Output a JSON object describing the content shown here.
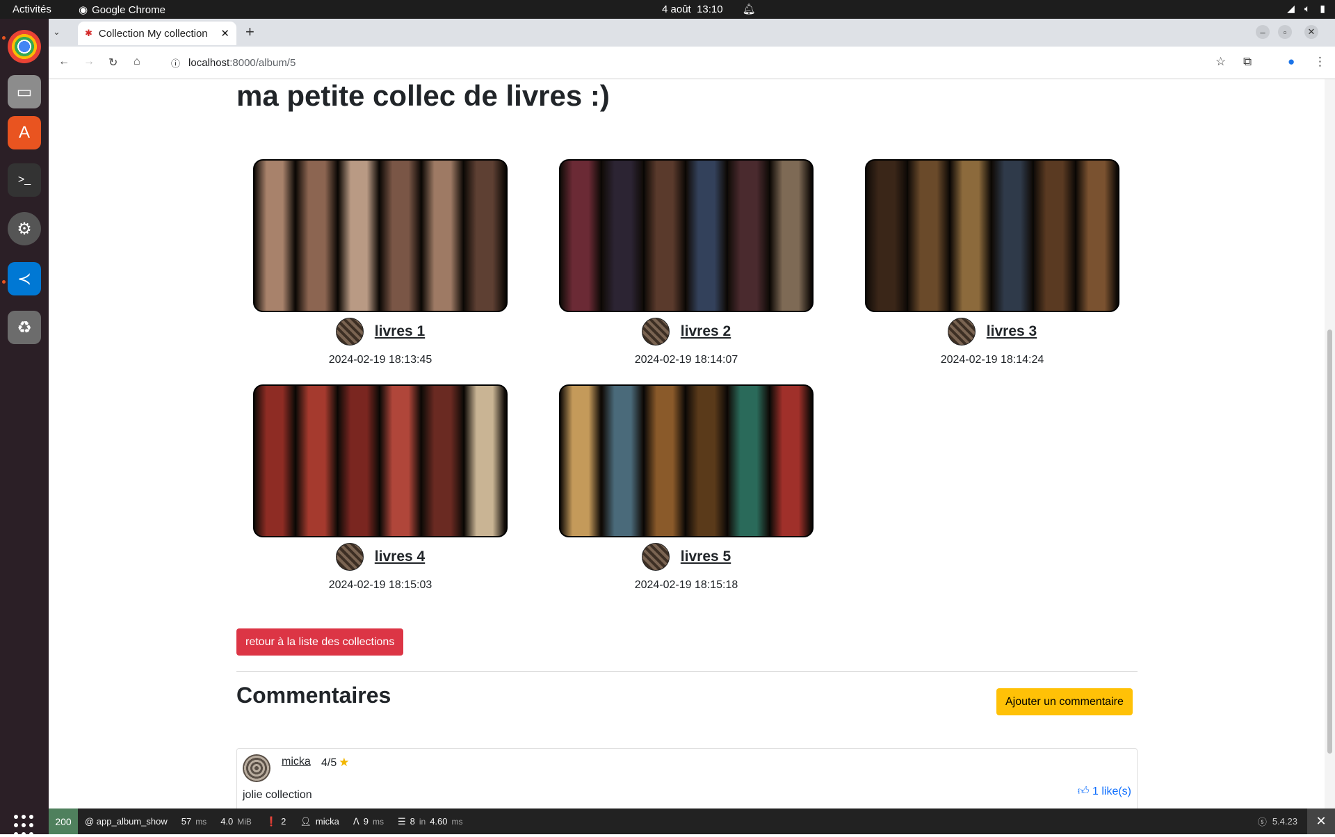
{
  "system": {
    "activities": "Activités",
    "app_name": "Google Chrome",
    "date": "4 août",
    "time": "13:10"
  },
  "browser": {
    "tab_title": "Collection My collection",
    "url_host": "localhost",
    "url_rest": ":8000/album/5"
  },
  "page": {
    "title": "ma petite collec de livres :)",
    "items": [
      {
        "name": "livres 1",
        "date": "2024-02-19 18:13:45",
        "palette": [
          "#a8826b",
          "#8c6551",
          "#b99a84",
          "#7a5646",
          "#9e7a64",
          "#5e4033"
        ]
      },
      {
        "name": "livres 2",
        "date": "2024-02-19 18:14:07",
        "palette": [
          "#6b2a35",
          "#2c2433",
          "#5a3a2c",
          "#33415b",
          "#4a2a2e",
          "#7e6a55"
        ]
      },
      {
        "name": "livres 3",
        "date": "2024-02-19 18:14:24",
        "palette": [
          "#3a2618",
          "#6a4a2a",
          "#8c6a3c",
          "#2f3a4a",
          "#5a3a22",
          "#7a5230"
        ]
      },
      {
        "name": "livres 4",
        "date": "2024-02-19 18:15:03",
        "palette": [
          "#8e2c24",
          "#a53a2e",
          "#7a2620",
          "#b0463a",
          "#6a2a22",
          "#c9b494"
        ]
      },
      {
        "name": "livres 5",
        "date": "2024-02-19 18:15:18",
        "palette": [
          "#c49a5a",
          "#4a6a7a",
          "#8a5a2a",
          "#5a3a1a",
          "#2a6a5a",
          "#a0302a"
        ]
      }
    ],
    "back_button": "retour à la liste des collections",
    "comments_title": "Commentaires",
    "add_comment_button": "Ajouter un commentaire",
    "comments": [
      {
        "user": "micka",
        "rating": "4/5",
        "text": "jolie collection",
        "likes": "1 like(s)"
      }
    ]
  },
  "symfony_bar": {
    "status": "200",
    "route": "@ app_album_show",
    "time_value": "57",
    "time_unit": "ms",
    "memory_value": "4.0",
    "memory_unit": "MiB",
    "logs": "2",
    "user": "micka",
    "cache_value": "9",
    "cache_unit": "ms",
    "db_queries": "8",
    "db_in": "in",
    "db_time": "4.60",
    "db_unit": "ms",
    "version": "5.4.23"
  }
}
